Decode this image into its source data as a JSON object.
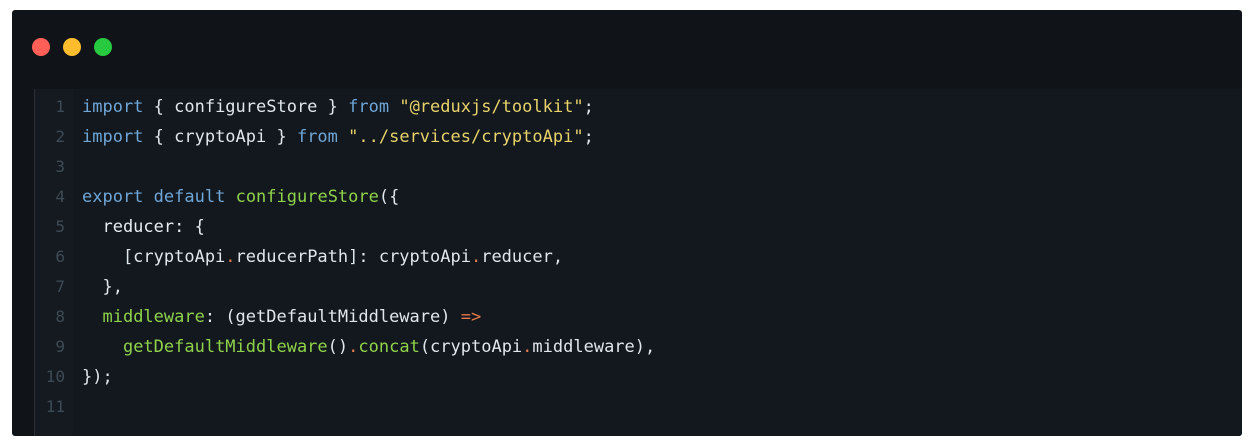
{
  "window": {
    "buttons": {
      "close_color": "#ff5f56",
      "minimize_color": "#ffbd2e",
      "maximize_color": "#27c93f"
    }
  },
  "editor": {
    "language": "javascript",
    "lines": [
      {
        "number": "1",
        "tokens": [
          {
            "t": "import",
            "c": "kw"
          },
          {
            "t": " { configureStore } ",
            "c": "punc"
          },
          {
            "t": "from",
            "c": "kw"
          },
          {
            "t": " ",
            "c": "punc"
          },
          {
            "t": "\"@reduxjs/toolkit\"",
            "c": "str"
          },
          {
            "t": ";",
            "c": "punc"
          }
        ]
      },
      {
        "number": "2",
        "tokens": [
          {
            "t": "import",
            "c": "kw"
          },
          {
            "t": " { cryptoApi } ",
            "c": "punc"
          },
          {
            "t": "from",
            "c": "kw"
          },
          {
            "t": " ",
            "c": "punc"
          },
          {
            "t": "\"../services/cryptoApi\"",
            "c": "str"
          },
          {
            "t": ";",
            "c": "punc"
          }
        ]
      },
      {
        "number": "3",
        "tokens": []
      },
      {
        "number": "4",
        "tokens": [
          {
            "t": "export",
            "c": "kw"
          },
          {
            "t": " ",
            "c": "punc"
          },
          {
            "t": "default",
            "c": "kw"
          },
          {
            "t": " ",
            "c": "punc"
          },
          {
            "t": "configureStore",
            "c": "fn"
          },
          {
            "t": "({",
            "c": "punc"
          }
        ]
      },
      {
        "number": "5",
        "tokens": [
          {
            "t": "  reducer: {",
            "c": "prop"
          }
        ]
      },
      {
        "number": "6",
        "tokens": [
          {
            "t": "    [cryptoApi",
            "c": "punc"
          },
          {
            "t": ".",
            "c": "arrow"
          },
          {
            "t": "reducerPath]: cryptoApi",
            "c": "punc"
          },
          {
            "t": ".",
            "c": "arrow"
          },
          {
            "t": "reducer,",
            "c": "punc"
          }
        ]
      },
      {
        "number": "7",
        "tokens": [
          {
            "t": "  },",
            "c": "punc"
          }
        ]
      },
      {
        "number": "8",
        "tokens": [
          {
            "t": "  ",
            "c": "punc"
          },
          {
            "t": "middleware",
            "c": "green-prop"
          },
          {
            "t": ": (getDefaultMiddleware) ",
            "c": "punc"
          },
          {
            "t": "=>",
            "c": "arrow"
          }
        ]
      },
      {
        "number": "9",
        "tokens": [
          {
            "t": "    ",
            "c": "punc"
          },
          {
            "t": "getDefaultMiddleware",
            "c": "fn"
          },
          {
            "t": "()",
            "c": "punc"
          },
          {
            "t": ".",
            "c": "arrow"
          },
          {
            "t": "concat",
            "c": "fn"
          },
          {
            "t": "(cryptoApi",
            "c": "punc"
          },
          {
            "t": ".",
            "c": "arrow"
          },
          {
            "t": "middleware),",
            "c": "punc"
          }
        ]
      },
      {
        "number": "10",
        "tokens": [
          {
            "t": "});",
            "c": "punc"
          }
        ]
      },
      {
        "number": "11",
        "tokens": []
      }
    ]
  }
}
